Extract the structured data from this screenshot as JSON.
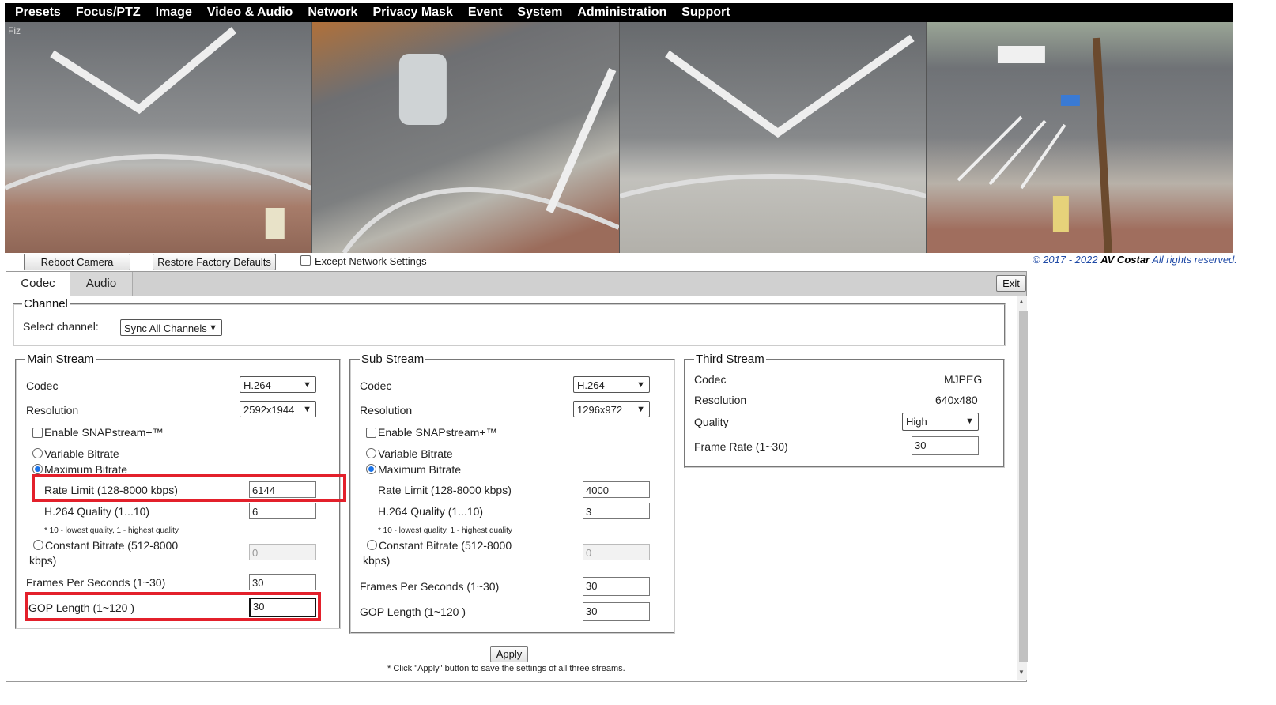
{
  "menu": [
    "Presets",
    "Focus/PTZ",
    "Image",
    "Video & Audio",
    "Network",
    "Privacy Mask",
    "Event",
    "System",
    "Administration",
    "Support"
  ],
  "video": {
    "overlay_label": "Fiz"
  },
  "toolbar": {
    "reboot_label": "Reboot Camera",
    "restore_label": "Restore Factory Defaults",
    "except_label": "Except Network Settings",
    "copyright_years": "© 2017 - 2022",
    "copyright_brand": "AV Costar",
    "copyright_rights": "All rights reserved."
  },
  "tabs": {
    "codec": "Codec",
    "audio": "Audio",
    "exit": "Exit"
  },
  "channel": {
    "legend": "Channel",
    "select_label": "Select channel:",
    "select_value": "Sync All Channels"
  },
  "main": {
    "legend": "Main Stream",
    "codec_label": "Codec",
    "codec_value": "H.264",
    "resolution_label": "Resolution",
    "resolution_value": "2592x1944",
    "snap_label": "Enable SNAPstream+™",
    "vbr_label": "Variable Bitrate",
    "mbr_label": "Maximum Bitrate",
    "rate_label": "Rate Limit (128-8000 kbps)",
    "rate_value": "6144",
    "quality_label": "H.264 Quality (1...10)",
    "quality_value": "6",
    "quality_note": "* 10 - lowest quality, 1 - highest quality",
    "cbr_label_1": "Constant Bitrate (512-8000",
    "cbr_label_2": "kbps)",
    "cbr_value": "0",
    "fps_label": "Frames Per Seconds  (1~30)",
    "fps_value": "30",
    "gop_label": "GOP Length (1~120 )",
    "gop_value": "30"
  },
  "sub": {
    "legend": "Sub Stream",
    "codec_label": "Codec",
    "codec_value": "H.264",
    "resolution_label": "Resolution",
    "resolution_value": "1296x972",
    "snap_label": "Enable SNAPstream+™",
    "vbr_label": "Variable Bitrate",
    "mbr_label": "Maximum Bitrate",
    "rate_label": "Rate Limit (128-8000 kbps)",
    "rate_value": "4000",
    "quality_label": "H.264 Quality (1...10)",
    "quality_value": "3",
    "quality_note": "* 10 - lowest quality, 1 - highest quality",
    "cbr_label_1": "Constant Bitrate (512-8000",
    "cbr_label_2": "kbps)",
    "cbr_value": "0",
    "fps_label": "Frames Per Seconds  (1~30)",
    "fps_value": "30",
    "gop_label": "GOP Length (1~120 )",
    "gop_value": "30"
  },
  "third": {
    "legend": "Third Stream",
    "codec_label": "Codec",
    "codec_value": "MJPEG",
    "resolution_label": "Resolution",
    "resolution_value": "640x480",
    "quality_label": "Quality",
    "quality_value": "High",
    "fps_label": "Frame Rate  (1~30)",
    "fps_value": "30"
  },
  "apply": {
    "label": "Apply",
    "note": "* Click \"Apply\" button to save the settings of all three streams."
  }
}
